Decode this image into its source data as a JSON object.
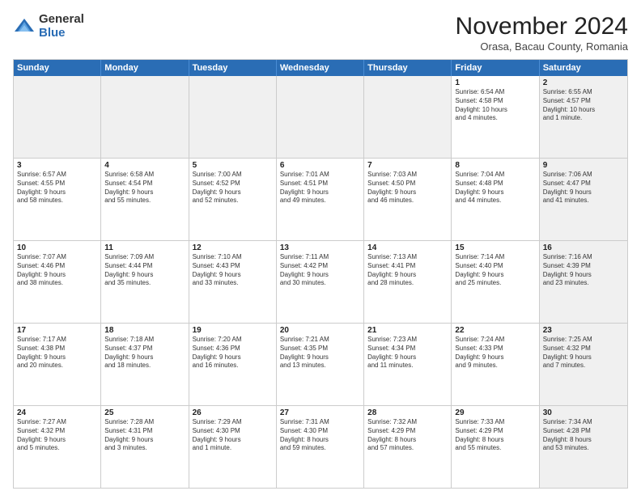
{
  "logo": {
    "general": "General",
    "blue": "Blue"
  },
  "title": "November 2024",
  "subtitle": "Orasa, Bacau County, Romania",
  "header_days": [
    "Sunday",
    "Monday",
    "Tuesday",
    "Wednesday",
    "Thursday",
    "Friday",
    "Saturday"
  ],
  "weeks": [
    [
      {
        "day": "",
        "info": "",
        "shaded": true
      },
      {
        "day": "",
        "info": "",
        "shaded": true
      },
      {
        "day": "",
        "info": "",
        "shaded": true
      },
      {
        "day": "",
        "info": "",
        "shaded": true
      },
      {
        "day": "",
        "info": "",
        "shaded": true
      },
      {
        "day": "1",
        "info": "Sunrise: 6:54 AM\nSunset: 4:58 PM\nDaylight: 10 hours\nand 4 minutes.",
        "shaded": false
      },
      {
        "day": "2",
        "info": "Sunrise: 6:55 AM\nSunset: 4:57 PM\nDaylight: 10 hours\nand 1 minute.",
        "shaded": true
      }
    ],
    [
      {
        "day": "3",
        "info": "Sunrise: 6:57 AM\nSunset: 4:55 PM\nDaylight: 9 hours\nand 58 minutes.",
        "shaded": false
      },
      {
        "day": "4",
        "info": "Sunrise: 6:58 AM\nSunset: 4:54 PM\nDaylight: 9 hours\nand 55 minutes.",
        "shaded": false
      },
      {
        "day": "5",
        "info": "Sunrise: 7:00 AM\nSunset: 4:52 PM\nDaylight: 9 hours\nand 52 minutes.",
        "shaded": false
      },
      {
        "day": "6",
        "info": "Sunrise: 7:01 AM\nSunset: 4:51 PM\nDaylight: 9 hours\nand 49 minutes.",
        "shaded": false
      },
      {
        "day": "7",
        "info": "Sunrise: 7:03 AM\nSunset: 4:50 PM\nDaylight: 9 hours\nand 46 minutes.",
        "shaded": false
      },
      {
        "day": "8",
        "info": "Sunrise: 7:04 AM\nSunset: 4:48 PM\nDaylight: 9 hours\nand 44 minutes.",
        "shaded": false
      },
      {
        "day": "9",
        "info": "Sunrise: 7:06 AM\nSunset: 4:47 PM\nDaylight: 9 hours\nand 41 minutes.",
        "shaded": true
      }
    ],
    [
      {
        "day": "10",
        "info": "Sunrise: 7:07 AM\nSunset: 4:46 PM\nDaylight: 9 hours\nand 38 minutes.",
        "shaded": false
      },
      {
        "day": "11",
        "info": "Sunrise: 7:09 AM\nSunset: 4:44 PM\nDaylight: 9 hours\nand 35 minutes.",
        "shaded": false
      },
      {
        "day": "12",
        "info": "Sunrise: 7:10 AM\nSunset: 4:43 PM\nDaylight: 9 hours\nand 33 minutes.",
        "shaded": false
      },
      {
        "day": "13",
        "info": "Sunrise: 7:11 AM\nSunset: 4:42 PM\nDaylight: 9 hours\nand 30 minutes.",
        "shaded": false
      },
      {
        "day": "14",
        "info": "Sunrise: 7:13 AM\nSunset: 4:41 PM\nDaylight: 9 hours\nand 28 minutes.",
        "shaded": false
      },
      {
        "day": "15",
        "info": "Sunrise: 7:14 AM\nSunset: 4:40 PM\nDaylight: 9 hours\nand 25 minutes.",
        "shaded": false
      },
      {
        "day": "16",
        "info": "Sunrise: 7:16 AM\nSunset: 4:39 PM\nDaylight: 9 hours\nand 23 minutes.",
        "shaded": true
      }
    ],
    [
      {
        "day": "17",
        "info": "Sunrise: 7:17 AM\nSunset: 4:38 PM\nDaylight: 9 hours\nand 20 minutes.",
        "shaded": false
      },
      {
        "day": "18",
        "info": "Sunrise: 7:18 AM\nSunset: 4:37 PM\nDaylight: 9 hours\nand 18 minutes.",
        "shaded": false
      },
      {
        "day": "19",
        "info": "Sunrise: 7:20 AM\nSunset: 4:36 PM\nDaylight: 9 hours\nand 16 minutes.",
        "shaded": false
      },
      {
        "day": "20",
        "info": "Sunrise: 7:21 AM\nSunset: 4:35 PM\nDaylight: 9 hours\nand 13 minutes.",
        "shaded": false
      },
      {
        "day": "21",
        "info": "Sunrise: 7:23 AM\nSunset: 4:34 PM\nDaylight: 9 hours\nand 11 minutes.",
        "shaded": false
      },
      {
        "day": "22",
        "info": "Sunrise: 7:24 AM\nSunset: 4:33 PM\nDaylight: 9 hours\nand 9 minutes.",
        "shaded": false
      },
      {
        "day": "23",
        "info": "Sunrise: 7:25 AM\nSunset: 4:32 PM\nDaylight: 9 hours\nand 7 minutes.",
        "shaded": true
      }
    ],
    [
      {
        "day": "24",
        "info": "Sunrise: 7:27 AM\nSunset: 4:32 PM\nDaylight: 9 hours\nand 5 minutes.",
        "shaded": false
      },
      {
        "day": "25",
        "info": "Sunrise: 7:28 AM\nSunset: 4:31 PM\nDaylight: 9 hours\nand 3 minutes.",
        "shaded": false
      },
      {
        "day": "26",
        "info": "Sunrise: 7:29 AM\nSunset: 4:30 PM\nDaylight: 9 hours\nand 1 minute.",
        "shaded": false
      },
      {
        "day": "27",
        "info": "Sunrise: 7:31 AM\nSunset: 4:30 PM\nDaylight: 8 hours\nand 59 minutes.",
        "shaded": false
      },
      {
        "day": "28",
        "info": "Sunrise: 7:32 AM\nSunset: 4:29 PM\nDaylight: 8 hours\nand 57 minutes.",
        "shaded": false
      },
      {
        "day": "29",
        "info": "Sunrise: 7:33 AM\nSunset: 4:29 PM\nDaylight: 8 hours\nand 55 minutes.",
        "shaded": false
      },
      {
        "day": "30",
        "info": "Sunrise: 7:34 AM\nSunset: 4:28 PM\nDaylight: 8 hours\nand 53 minutes.",
        "shaded": true
      }
    ]
  ]
}
